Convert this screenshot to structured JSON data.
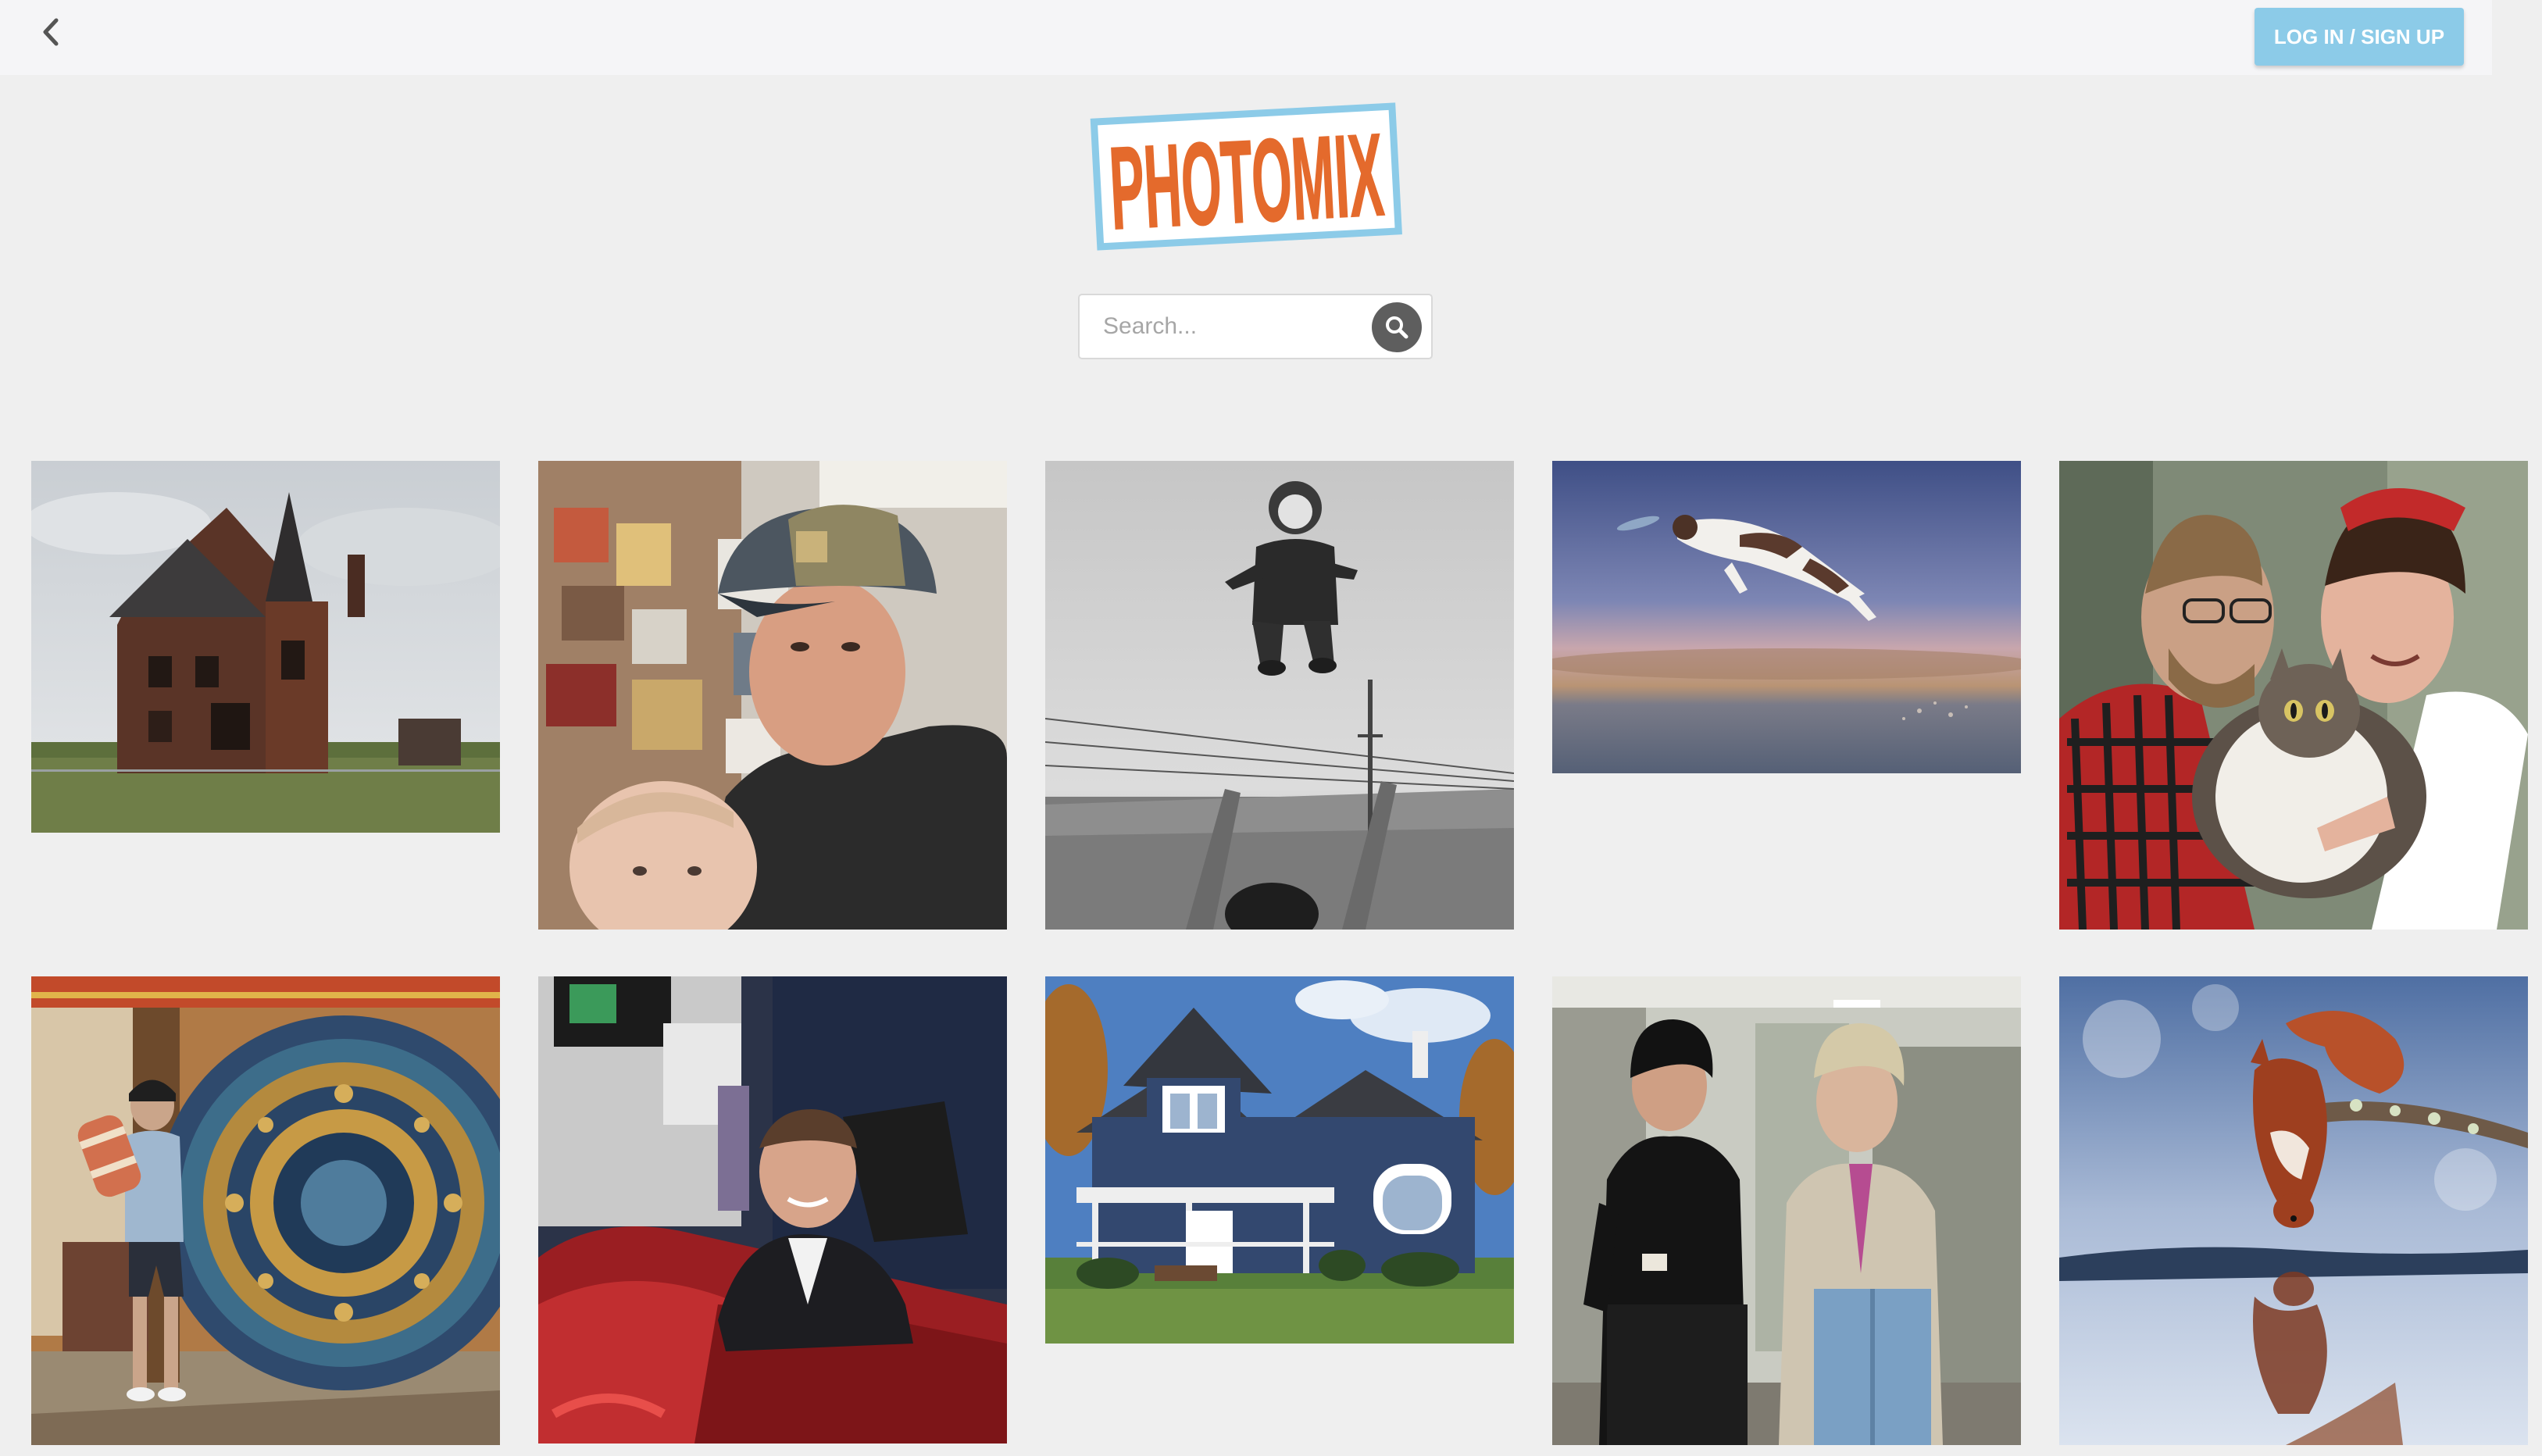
{
  "header": {
    "back_icon": "chevron-left-icon",
    "login_label": "LOG IN / SIGN UP"
  },
  "logo": {
    "text": "PHOTOMIX",
    "colors": {
      "text": "#e46a2c",
      "border": "#8ccbe8"
    }
  },
  "search": {
    "placeholder": "Search...",
    "value": "",
    "icon": "search-icon"
  },
  "gallery": {
    "photos": [
      {
        "subject": "abandoned Victorian house"
      },
      {
        "subject": "man in cap with baby"
      },
      {
        "subject": "child tossed in the air"
      },
      {
        "subject": "dog leaping for frisbee"
      },
      {
        "subject": "couple kissing a cat"
      },
      {
        "subject": "boy striking a giant gong"
      },
      {
        "subject": "man seated in red sports car"
      },
      {
        "subject": "blue suburban house"
      },
      {
        "subject": "two men walking in hallway"
      },
      {
        "subject": "squirrel reflected in water"
      }
    ]
  },
  "colors": {
    "page_bg": "#efefef",
    "topbar_bg": "#f5f5f7",
    "accent": "#8ccbe8",
    "logo_orange": "#e46a2c"
  }
}
